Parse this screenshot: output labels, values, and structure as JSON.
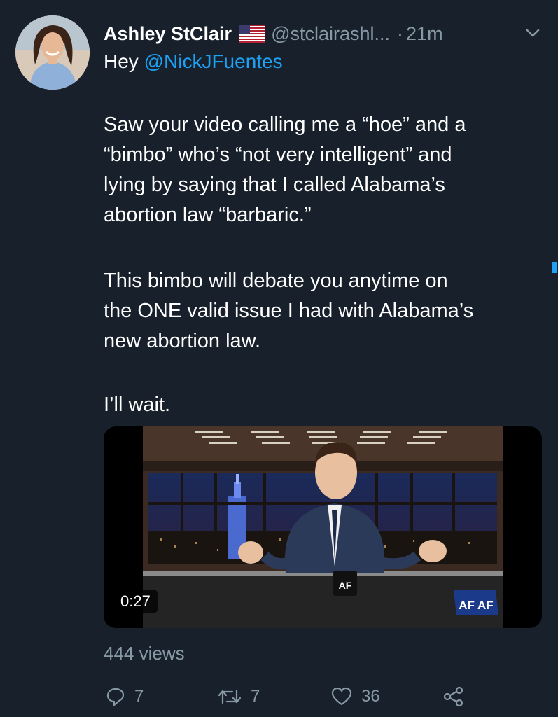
{
  "tweet": {
    "author_name": "Ashley StClair",
    "flag_icon": "us-flag-icon",
    "handle": "@stclairashl...",
    "separator": "·",
    "time": "21m",
    "reply_prefix": "Hey ",
    "reply_mention": "@NickJFuentes",
    "paragraphs": [
      [
        "Saw your video calling me a “hoe” and a",
        "“bimbo” who’s “not very intelligent” and",
        "lying by saying that I called Alabama’s",
        "abortion law “barbaric.”"
      ],
      [
        "This bimbo will debate you anytime on",
        "the ONE valid issue I had with Alabama’s",
        "new abortion law."
      ],
      [
        "I’ll wait."
      ]
    ],
    "video": {
      "duration": "0:27",
      "mug_logo": "AF",
      "corner_logo": "AF AF"
    },
    "views": "444 views",
    "actions": {
      "reply_count": "7",
      "retweet_count": "7",
      "like_count": "36"
    }
  },
  "colors": {
    "background": "#17202b",
    "secondary_text": "#8899a6",
    "link": "#1da1f2"
  }
}
